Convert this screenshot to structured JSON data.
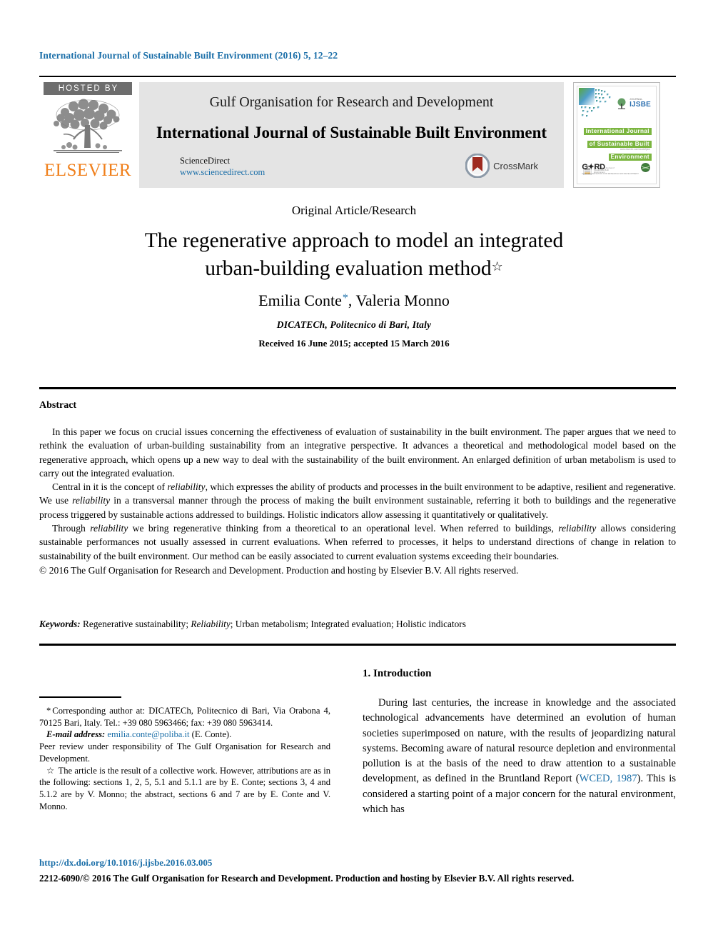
{
  "running_head": "International Journal of Sustainable Built Environment (2016) 5, 12–22",
  "header": {
    "hosted_by": "HOSTED BY",
    "publisher": "ELSEVIER",
    "banner_org": "Gulf Organisation for Research and Development",
    "banner_journal": "International Journal of Sustainable Built Environment",
    "sciencedirect": "ScienceDirect",
    "sciencedirect_url": "www.sciencedirect.com",
    "crossmark_label": "CrossMark",
    "cover": {
      "logo_small": "JOURNAL",
      "logo_big": "IJSBE",
      "title_line1": "International Journal",
      "title_line2": "of Sustainable Built",
      "title_line3": "Environment",
      "subtitle": "www.elsevier.com/locate/ijsbe",
      "bottom_right_word": "G✦RD",
      "bottom_right_sub": "GULF ORGANISATION FOR RESEARCH AND DEVELOPMENT",
      "bottom_left_sub": "International Journal of Sustainable Built Environment"
    }
  },
  "article_type": "Original Article/Research",
  "title": {
    "line1": "The regenerative approach to model an integrated",
    "line2": "urban-building evaluation method",
    "footnote_marker": "☆"
  },
  "authors": {
    "name1": "Emilia Conte",
    "corresponding_marker": "*",
    "name2": ", Valeria Monno",
    "affiliation": "DICATECh, Politecnico di Bari, Italy",
    "history": "Received 16 June 2015; accepted 15 March 2016"
  },
  "abstract": {
    "heading": "Abstract",
    "p1_a": "In this paper we focus on crucial issues concerning the effectiveness of evaluation of sustainability in the built environment. The paper argues that we need to rethink the evaluation of urban-building sustainability from an integrative perspective. It advances a theoretical and methodological model based on the regenerative approach, which opens up a new way to deal with the sustainability of the built environment. An enlarged definition of urban metabolism is used to carry out the integrated evaluation.",
    "p2_a": "Central in it is the concept of ",
    "p2_i1": "reliability",
    "p2_b": ", which expresses the ability of products and processes in the built environment to be adaptive, resilient and regenerative. We use ",
    "p2_i2": "reliability",
    "p2_c": " in a transversal manner through the process of making the built environment sustainable, referring it both to buildings and the regenerative process triggered by sustainable actions addressed to buildings. Holistic indicators allow assessing it quantitatively or qualitatively.",
    "p3_a": "Through ",
    "p3_i1": "reliability",
    "p3_b": " we bring regenerative thinking from a theoretical to an operational level. When referred to buildings, ",
    "p3_i2": "reliability",
    "p3_c": " allows considering sustainable performances not usually assessed in current evaluations. When referred to processes, it helps to understand directions of change in relation to sustainability of the built environment. Our method can be easily associated to current evaluation systems exceeding their boundaries.",
    "copyright": "© 2016 The Gulf Organisation for Research and Development. Production and hosting by Elsevier B.V. All rights reserved."
  },
  "keywords": {
    "label": "Keywords:",
    "k1": "Regenerative sustainability;",
    "k2": "Reliability",
    "k3": "; Urban metabolism; Integrated evaluation; Holistic indicators"
  },
  "footnotes": {
    "corresponding_marker": "*",
    "corresponding": "Corresponding author at: DICATECh, Politecnico di Bari, Via Orabona 4, 70125 Bari, Italy. Tel.: +39 080 5963466; fax: +39 080 5963414.",
    "email_label": "E-mail address:",
    "email": "emilia.conte@poliba.it",
    "email_attrib": "(E. Conte).",
    "peer_review": "Peer review under responsibility of The Gulf Organisation for Research and Development.",
    "star_marker": "☆",
    "attribution": "The article is the result of a collective work. However, attributions are as in the following: sections 1, 2, 5, 5.1 and 5.1.1 are by E. Conte; sections 3, 4 and 5.1.2 are by V. Monno; the abstract, sections 6 and 7 are by E. Conte and V. Monno."
  },
  "introduction": {
    "heading": "1. Introduction",
    "p1_a": "During last centuries, the increase in knowledge and the associated technological advancements have determined an evolution of human societies superimposed on nature, with the results of jeopardizing natural systems. Becoming aware of natural resource depletion and environmental pollution is at the basis of the need to draw attention to a sustainable development, as defined in the Bruntland Report (",
    "p1_cite": "WCED, 1987",
    "p1_b": "). This is considered a starting point of a major concern for the natural environment, which has"
  },
  "footer": {
    "doi": "http://dx.doi.org/10.1016/j.ijsbe.2016.03.005",
    "copyright": "2212-6090/© 2016 The Gulf Organisation for Research and Development. Production and hosting by Elsevier B.V. All rights reserved."
  },
  "colors": {
    "link": "#1a6ea8",
    "elsevier_orange": "#F07F1A",
    "cover_green": "#7bb53f",
    "banner_grey": "#e4e4e4"
  }
}
